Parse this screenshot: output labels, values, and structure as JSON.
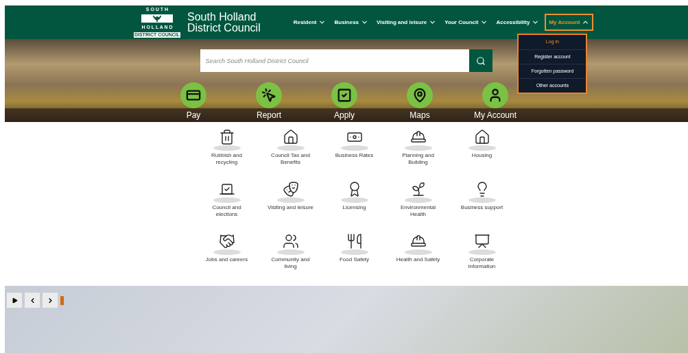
{
  "header": {
    "logo": {
      "top": "S O U T H",
      "bottom": "H O L L A N D",
      "band": "DISTRICT COUNCIL"
    },
    "site_name": [
      "South Holland",
      "District Council"
    ],
    "nav": [
      {
        "label": "Resident",
        "expanded": false
      },
      {
        "label": "Business",
        "expanded": false
      },
      {
        "label": "Visiting and leisure",
        "expanded": false
      },
      {
        "label": "Your Council",
        "expanded": false
      },
      {
        "label": "Accessibility",
        "expanded": false
      },
      {
        "label": "My Account",
        "expanded": true
      }
    ],
    "account_menu": [
      {
        "label": "Log in",
        "selected": true
      },
      {
        "label": "Register account",
        "selected": false
      },
      {
        "label": "Forgotten password",
        "selected": false
      },
      {
        "label": "Other accounts",
        "selected": false
      }
    ]
  },
  "search": {
    "placeholder": "Search South Holland District Council"
  },
  "quick_links": [
    "Pay",
    "Report",
    "Apply",
    "Maps",
    "My Account"
  ],
  "services": [
    [
      "Rubbish and",
      "recycling"
    ],
    [
      "Council Tax and",
      "Benefits"
    ],
    [
      "Business Rates"
    ],
    [
      "Planning and",
      "Building"
    ],
    [
      "Housing"
    ],
    [
      "Council and",
      "elections"
    ],
    [
      "Visiting and leisure"
    ],
    [
      "Licensing"
    ],
    [
      "Environmental",
      "Health"
    ],
    [
      "Business support"
    ],
    [
      "Jobs and careers"
    ],
    [
      "Community and",
      "living"
    ],
    [
      "Food Safety"
    ],
    [
      "Health and Safety"
    ],
    [
      "Corporate",
      "information"
    ]
  ],
  "slideshow": {
    "playing": false
  }
}
